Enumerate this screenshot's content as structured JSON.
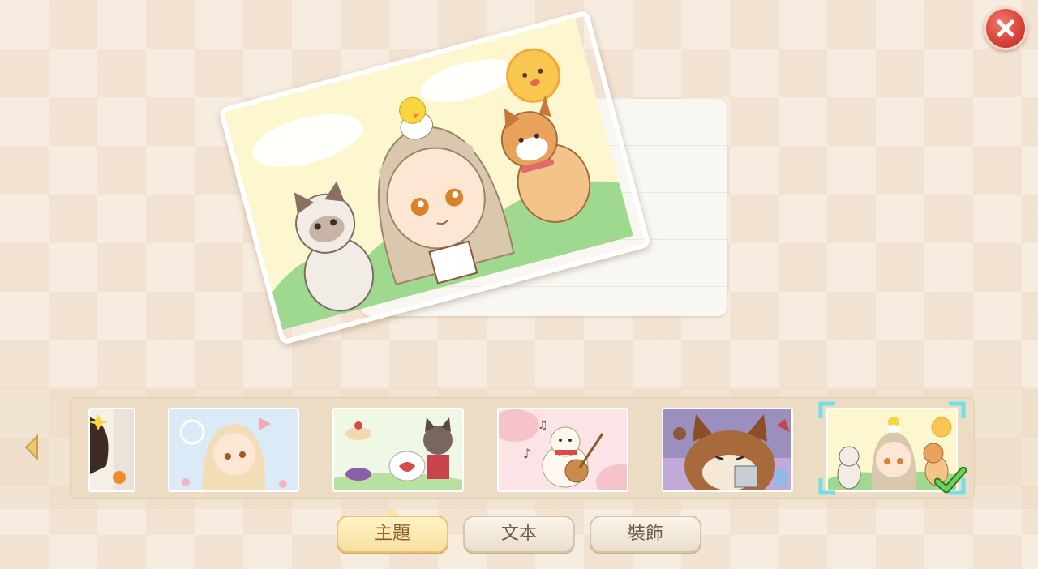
{
  "tabs": [
    {
      "label": "主題",
      "active": true
    },
    {
      "label": "文本",
      "active": false
    },
    {
      "label": "裝飾",
      "active": false
    }
  ],
  "themes": [
    {
      "name": "partial-girl-theme"
    },
    {
      "name": "blonde-girl-bow-theme"
    },
    {
      "name": "tea-party-wolf-theme"
    },
    {
      "name": "hamster-music-theme"
    },
    {
      "name": "shiba-dog-cleaver-theme"
    },
    {
      "name": "girl-cat-shiba-theme",
      "selected": true
    }
  ],
  "icons": {
    "close": "close-icon",
    "prev": "chevron-left-icon",
    "selected": "checkmark-icon"
  },
  "colors": {
    "close_button": "#d9443a",
    "selected_check": "#4caf3a",
    "selection_frame": "#6fe0e6",
    "active_tab": "#f8dfa0"
  }
}
